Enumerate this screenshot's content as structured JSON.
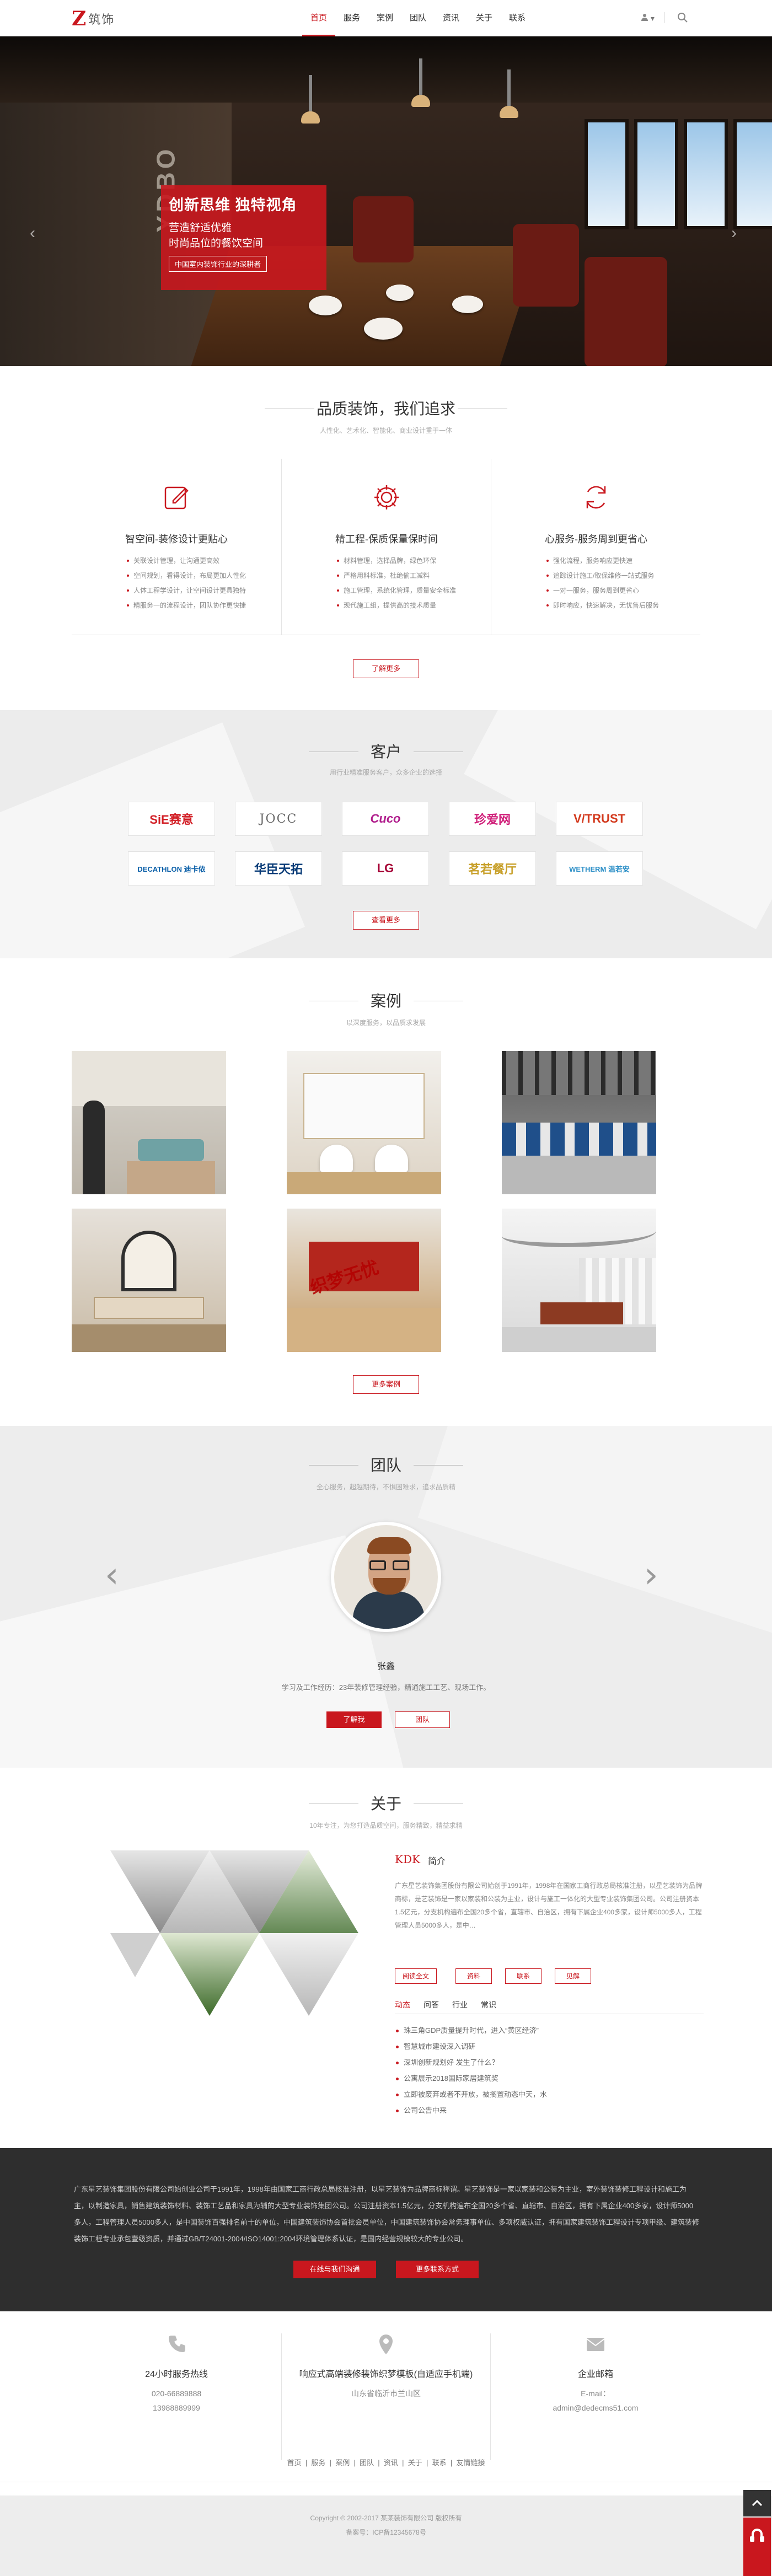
{
  "header": {
    "logo_letter": "Z",
    "logo_text": "筑饰",
    "nav": [
      "首页",
      "服务",
      "案例",
      "团队",
      "资讯",
      "关于",
      "联系"
    ],
    "user_caret": "▾"
  },
  "banner": {
    "headline": "创新思维 独特视角",
    "line1": "营造舒适优雅",
    "line2": "时尚品位的餐饮空间",
    "tag": "中国室内装饰行业的深耕者",
    "wall_text": "YDBO"
  },
  "pursuit": {
    "title": "品质装饰，我们追求",
    "subtitle": "人性化、艺术化、智能化、商业设计重于一体",
    "columns": [
      {
        "title": "智空间-装修设计更贴心",
        "items": [
          "关联设计管理，让沟通更高效",
          "空间规划，看得设计，布局更加人性化",
          "人体工程学设计，让空间设计更具独特",
          "精服务一的流程设计，团队协作更快捷"
        ]
      },
      {
        "title": "精工程-保质保量保时间",
        "items": [
          "材料管理，选择品牌，绿色环保",
          "严格用料标准，杜绝偷工减料",
          "施工管理，系统化管理，质量安全标准",
          "现代施工组，提供高的技术质量"
        ]
      },
      {
        "title": "心服务-服务周到更省心",
        "items": [
          "强化流程，服务响应更快速",
          "追踪设计施工/取保维修一站式服务",
          "一对一服务，服务周到更省心",
          "即时响应，快速解决，无忧售后服务"
        ]
      }
    ],
    "button": "了解更多"
  },
  "clients": {
    "title": "客户",
    "subtitle": "用行业精准服务客户，众多企业的选择",
    "logos": [
      {
        "text": "SiE赛意",
        "color": "#d21f26"
      },
      {
        "text": "JOCC",
        "color": "#666666"
      },
      {
        "text": "Cuco",
        "color": "#b01d8c"
      },
      {
        "text": "珍爱网",
        "color": "#d0207a"
      },
      {
        "text": "V/TRUST",
        "color": "#d33a1e"
      },
      {
        "text": "DECATHLON 迪卡侬",
        "color": "#0a5fa8"
      },
      {
        "text": "华臣天拓",
        "color": "#0a3c78"
      },
      {
        "text": "LG",
        "color": "#a50034"
      },
      {
        "text": "茗若餐厅",
        "color": "#c8a02a"
      },
      {
        "text": "WETHERM 温若安",
        "color": "#2c8fc7"
      }
    ],
    "button": "查看更多"
  },
  "cases": {
    "title": "案例",
    "subtitle": "以深度服务，以品质求发展",
    "button": "更多案例",
    "watermark": "织梦无忧"
  },
  "team": {
    "title": "团队",
    "subtitle": "全心服务，超越期待，不惧困难求，追求品质精",
    "name": "张鑫",
    "desc": "学习及工作经历：23年装修管理经验，精通施工工艺、现场工作。",
    "btn_primary": "了解我",
    "btn_secondary": "团队",
    "prev": "‹",
    "next": "›"
  },
  "about": {
    "title": "关于",
    "subtitle": "10年专注，为您打造品质空间，服务精致，精益求精",
    "brand": "KDK",
    "heading": "简介",
    "intro": "广东星艺装饰集团股份有限公司始创于1991年，1998年在国家工商行政总局核准注册，以星艺装饰为品牌商标，是艺装饰是一家以家装和公装为主业，设计与施工一体化的大型专业装饰集团公司。公司注册资本1.5亿元，分支机构遍布全国20多个省，直辖市、自治区，拥有下属企业400多家，设计师5000多人，工程管理人员5000多人，是中…",
    "buttons": [
      "阅读全文",
      "资料",
      "联系",
      "见解"
    ],
    "tabs": [
      "动态",
      "问答",
      "行业",
      "常识"
    ],
    "news": [
      "珠三角GDP质量提升时代，进入“黄区经济”",
      "智慧城市建设深入调研",
      "深圳创新规划好 发生了什么？",
      "公寓展示2018国际家居建筑奖",
      "立即被废弃或者不开放，被搁置动态中天，水",
      "公司公告中来"
    ]
  },
  "company": {
    "text": "广东星艺装饰集团股份有限公司始创业公司于1991年，1998年由国家工商行政总局核准注册，以星艺装饰为品牌商标称谓。星艺装饰是一家以家装和公装为主业，室外装饰装修工程设计和施工为主，以制造家具，销售建筑装饰材料、装饰工艺品和家具为辅的大型专业装饰集团公司。公司注册资本1.5亿元，分支机构遍布全国20多个省、直辖市、自治区，拥有下属企业400多家，设计师5000多人，工程管理人员5000多人，是中国装饰百强排名前十的单位，中国建筑装饰协会首批会员单位，中国建筑装饰协会常务理事单位、多项权威认证，拥有国家建筑装饰工程设计专项甲级、建筑装修装饰工程专业承包壹级资质，并通过GB/T24001-2004/ISO14001:2004环境管理体系认证，是国内经营规模较大的专业公司。",
    "btn_contact": "在线与我们沟通",
    "btn_more": "更多联系方式"
  },
  "contact": {
    "cols": [
      {
        "title": "24小时服务热线",
        "lines": [
          "020-66889888",
          "13988889999"
        ]
      },
      {
        "title": "响应式高端装修装饰织梦模板(自适应手机端)",
        "lines": [
          "山东省临沂市兰山区"
        ]
      },
      {
        "title": "企业邮箱",
        "lines": [
          "E-mail：",
          "admin@dedecms51.com"
        ]
      }
    ]
  },
  "footer": {
    "nav": [
      "首页",
      "服务",
      "案例",
      "团队",
      "资讯",
      "关于",
      "联系",
      "友情链接"
    ],
    "copyright": "Copyright © 2002-2017 某某装饰有限公司 版权所有",
    "icp": "备案号：ICP备12345678号"
  },
  "colors": {
    "accent": "#c9171e",
    "dark": "#2e2e2e",
    "gray_bg": "#ececec"
  }
}
